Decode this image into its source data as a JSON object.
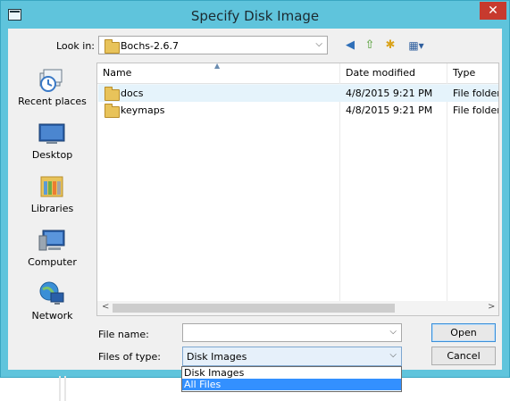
{
  "window": {
    "title": "Specify Disk Image",
    "close_glyph": "✕"
  },
  "lookin": {
    "label": "Look in:",
    "value": "Bochs-2.6.7",
    "chevron": "⌵"
  },
  "toolbar": [
    {
      "name": "back-icon",
      "glyph": "◀"
    },
    {
      "name": "up-folder-icon",
      "glyph": "⇧"
    },
    {
      "name": "new-folder-icon",
      "glyph": "✱"
    },
    {
      "name": "view-menu-icon",
      "glyph": "▦▾"
    }
  ],
  "places": [
    {
      "name": "recent-places",
      "label": "Recent places",
      "icon": "recent-places-icon"
    },
    {
      "name": "desktop",
      "label": "Desktop",
      "icon": "desktop-icon"
    },
    {
      "name": "libraries",
      "label": "Libraries",
      "icon": "libraries-icon"
    },
    {
      "name": "computer",
      "label": "Computer",
      "icon": "computer-icon"
    },
    {
      "name": "network",
      "label": "Network",
      "icon": "network-icon"
    }
  ],
  "columns": {
    "name": "Name",
    "date": "Date modified",
    "type": "Type"
  },
  "files": [
    {
      "name": "docs",
      "date": "4/8/2015 9:21 PM",
      "type": "File folder"
    },
    {
      "name": "keymaps",
      "date": "4/8/2015 9:21 PM",
      "type": "File folder"
    }
  ],
  "scroll": {
    "left": "<",
    "right": ">"
  },
  "filename": {
    "label": "File name:",
    "value": "",
    "chevron": "⌵"
  },
  "filetype": {
    "label": "Files of type:",
    "value": "Disk Images",
    "chevron": "⌵",
    "options": [
      "Disk Images",
      "All Files"
    ],
    "highlighted_option": "All Files"
  },
  "buttons": {
    "open": "Open",
    "cancel": "Cancel"
  },
  "colors": {
    "title_bar": "#5fc4dc",
    "close": "#c73a2e",
    "highlight": "#3390ff",
    "selected_row": "#e5f3fb"
  }
}
